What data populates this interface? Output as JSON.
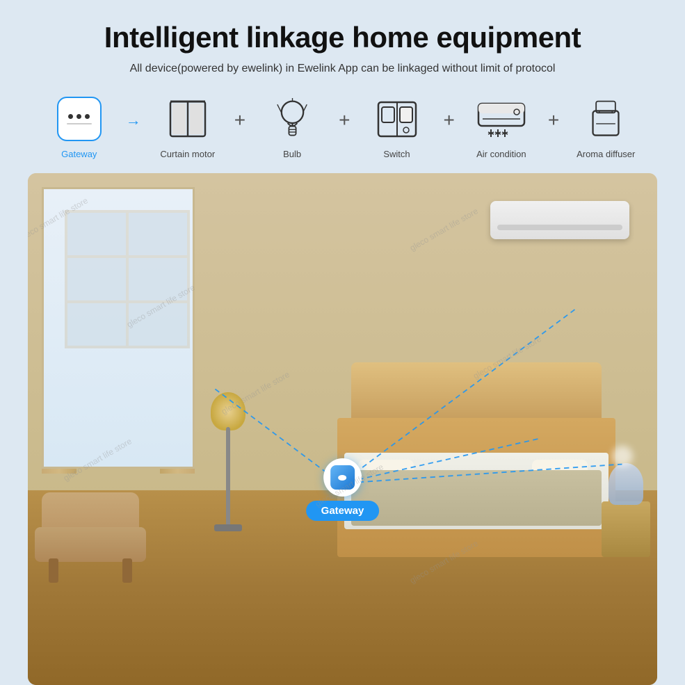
{
  "page": {
    "background_color": "#dde8f2"
  },
  "header": {
    "title": "Intelligent linkage home equipment",
    "subtitle": "All device(powered by ewelink) in Ewelink App can be linkaged without limit of protocol"
  },
  "devices": [
    {
      "id": "gateway",
      "label": "Gateway",
      "label_color": "blue",
      "icon_type": "gateway"
    },
    {
      "id": "curtain-motor",
      "label": "Curtain motor",
      "label_color": "default",
      "icon_type": "curtain"
    },
    {
      "id": "bulb",
      "label": "Bulb",
      "label_color": "default",
      "icon_type": "bulb"
    },
    {
      "id": "switch",
      "label": "Switch",
      "label_color": "default",
      "icon_type": "switch"
    },
    {
      "id": "air-condition",
      "label": "Air condition",
      "label_color": "default",
      "icon_type": "ac"
    },
    {
      "id": "aroma-diffuser",
      "label": "Aroma diffuser",
      "label_color": "default",
      "icon_type": "diffuser"
    }
  ],
  "room": {
    "gateway_label": "Gateway",
    "connection_color": "#2196f3"
  },
  "watermarks": [
    "gleco smart life store",
    "gleco smart life store",
    "gleco smart life store"
  ]
}
